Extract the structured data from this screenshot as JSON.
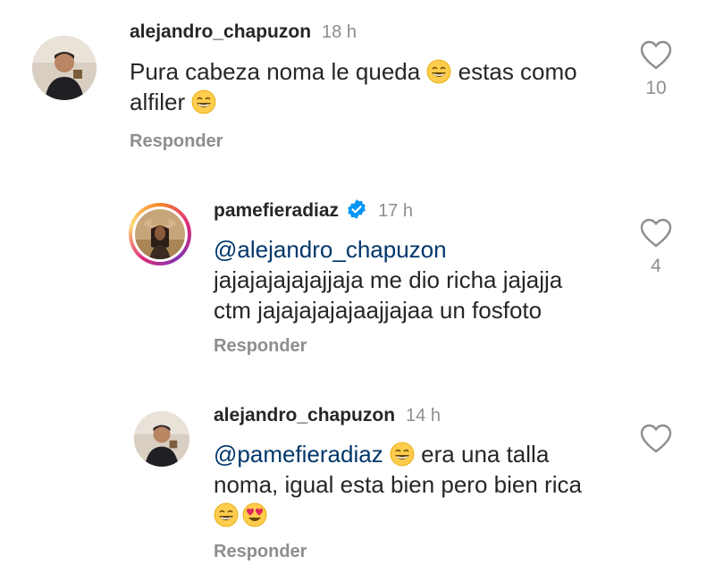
{
  "comments": [
    {
      "username": "alejandro_chapuzon",
      "time": "18 h",
      "text_before": "Pura cabeza noma le queda ",
      "text_mid": " estas como",
      "text_line2": "alfiler ",
      "reply_label": "Responder",
      "likes": "10"
    },
    {
      "username": "pamefieradiaz",
      "time": "17 h",
      "mention": "@alejandro_chapuzon",
      "line2": "jajajajajajajjaja me dio richa jajajja",
      "line3": "ctm jajajajajajaajjajaa un fosfoto",
      "reply_label": "Responder",
      "likes": "4"
    },
    {
      "username": "alejandro_chapuzon",
      "time": "14 h",
      "mention": "@pamefieradiaz",
      "text_after": " era una talla",
      "line2": "noma, igual esta bien pero bien rica",
      "reply_label": "Responder"
    }
  ],
  "colors": {
    "text": "#262626",
    "secondary": "#8e8e8e",
    "mention": "#00376b",
    "verified": "#0095f6"
  },
  "icons": {
    "like": "heart-outline-icon",
    "verified": "verified-badge-icon",
    "emoji_laugh": "grinning-sweat-emoji",
    "emoji_hearts": "heart-eyes-emoji"
  }
}
